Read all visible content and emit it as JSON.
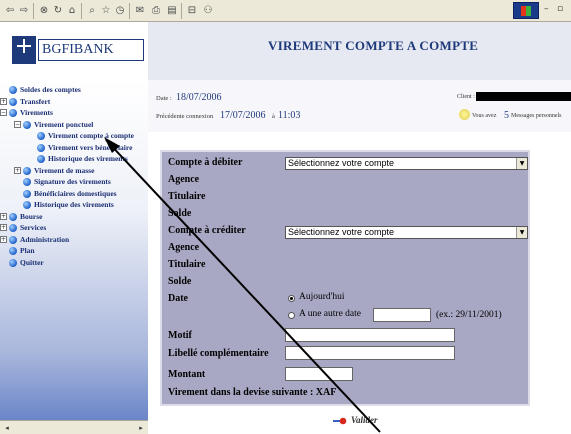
{
  "browser": {
    "toolbar": {
      "back": "⇦",
      "forward": "⇨",
      "stop": "⊗",
      "refresh": "↻",
      "home": "⌂",
      "search": "⌕",
      "favorites": "☆",
      "history": "◷",
      "mail": "✉",
      "print": "⎙",
      "edit": "▤",
      "discuss": "⊟",
      "messenger": "⚇"
    },
    "window": {
      "minimize": "–",
      "maximize": "▫"
    }
  },
  "brand": {
    "name": "BGFIBANK",
    "logo_sub": "BGFI"
  },
  "nav": {
    "items": [
      {
        "label": "Soldes des comptes",
        "depth": 0,
        "toggle": ""
      },
      {
        "label": "Transfert",
        "depth": 0,
        "toggle": "+"
      },
      {
        "label": "Virements",
        "depth": 0,
        "toggle": "−"
      },
      {
        "label": "Virement ponctuel",
        "depth": 1,
        "toggle": "−"
      },
      {
        "label": "Virement compte à compte",
        "depth": 2,
        "toggle": ""
      },
      {
        "label": "Virement vers bénéficiaire",
        "depth": 2,
        "toggle": ""
      },
      {
        "label": "Historique des virements",
        "depth": 2,
        "toggle": ""
      },
      {
        "label": "Virement de masse",
        "depth": 1,
        "toggle": "+"
      },
      {
        "label": "Signature des virements",
        "depth": 1,
        "toggle": ""
      },
      {
        "label": "Bénéficiaires domestiques",
        "depth": 1,
        "toggle": ""
      },
      {
        "label": "Historique des virements",
        "depth": 1,
        "toggle": ""
      },
      {
        "label": "Bourse",
        "depth": 0,
        "toggle": "+"
      },
      {
        "label": "Services",
        "depth": 0,
        "toggle": "+"
      },
      {
        "label": "Administration",
        "depth": 0,
        "toggle": "+"
      },
      {
        "label": "Plan",
        "depth": 0,
        "toggle": ""
      },
      {
        "label": "Quitter",
        "depth": 0,
        "toggle": ""
      }
    ],
    "scroll_left": "◂",
    "scroll_right": "▸"
  },
  "header": {
    "title": "VIREMENT COMPTE A COMPTE"
  },
  "info": {
    "date_label": "Date :",
    "date_value": "18/07/2006",
    "prev_label": "Précédente connexion",
    "prev_date": "17/07/2006",
    "prev_sep": "à",
    "prev_time": "11:03",
    "client_label": "Client :",
    "msg_pre": "Vous avez",
    "msg_count": "5",
    "msg_post": "Messages personnels"
  },
  "form": {
    "debit_label": "Compte à débiter",
    "debit_select": "Sélectionnez votre compte",
    "agence_label_1": "Agence",
    "titulaire_label_1": "Titulaire",
    "solde_label_1": "Solde",
    "credit_label": "Compte à créditer",
    "credit_select": "Sélectionnez votre compte",
    "agence_label_2": "Agence",
    "titulaire_label_2": "Titulaire",
    "solde_label_2": "Solde",
    "date_label": "Date",
    "date_today": "Aujourd'hui",
    "date_other": "A une autre date",
    "date_hint": "(ex.: 29/11/2001)",
    "motif_label": "Motif",
    "libelle_label": "Libellé complémentaire",
    "montant_label": "Montant",
    "currency_label": "Virement dans la devise suivante : XAF"
  },
  "actions": {
    "validate": "Valider"
  }
}
